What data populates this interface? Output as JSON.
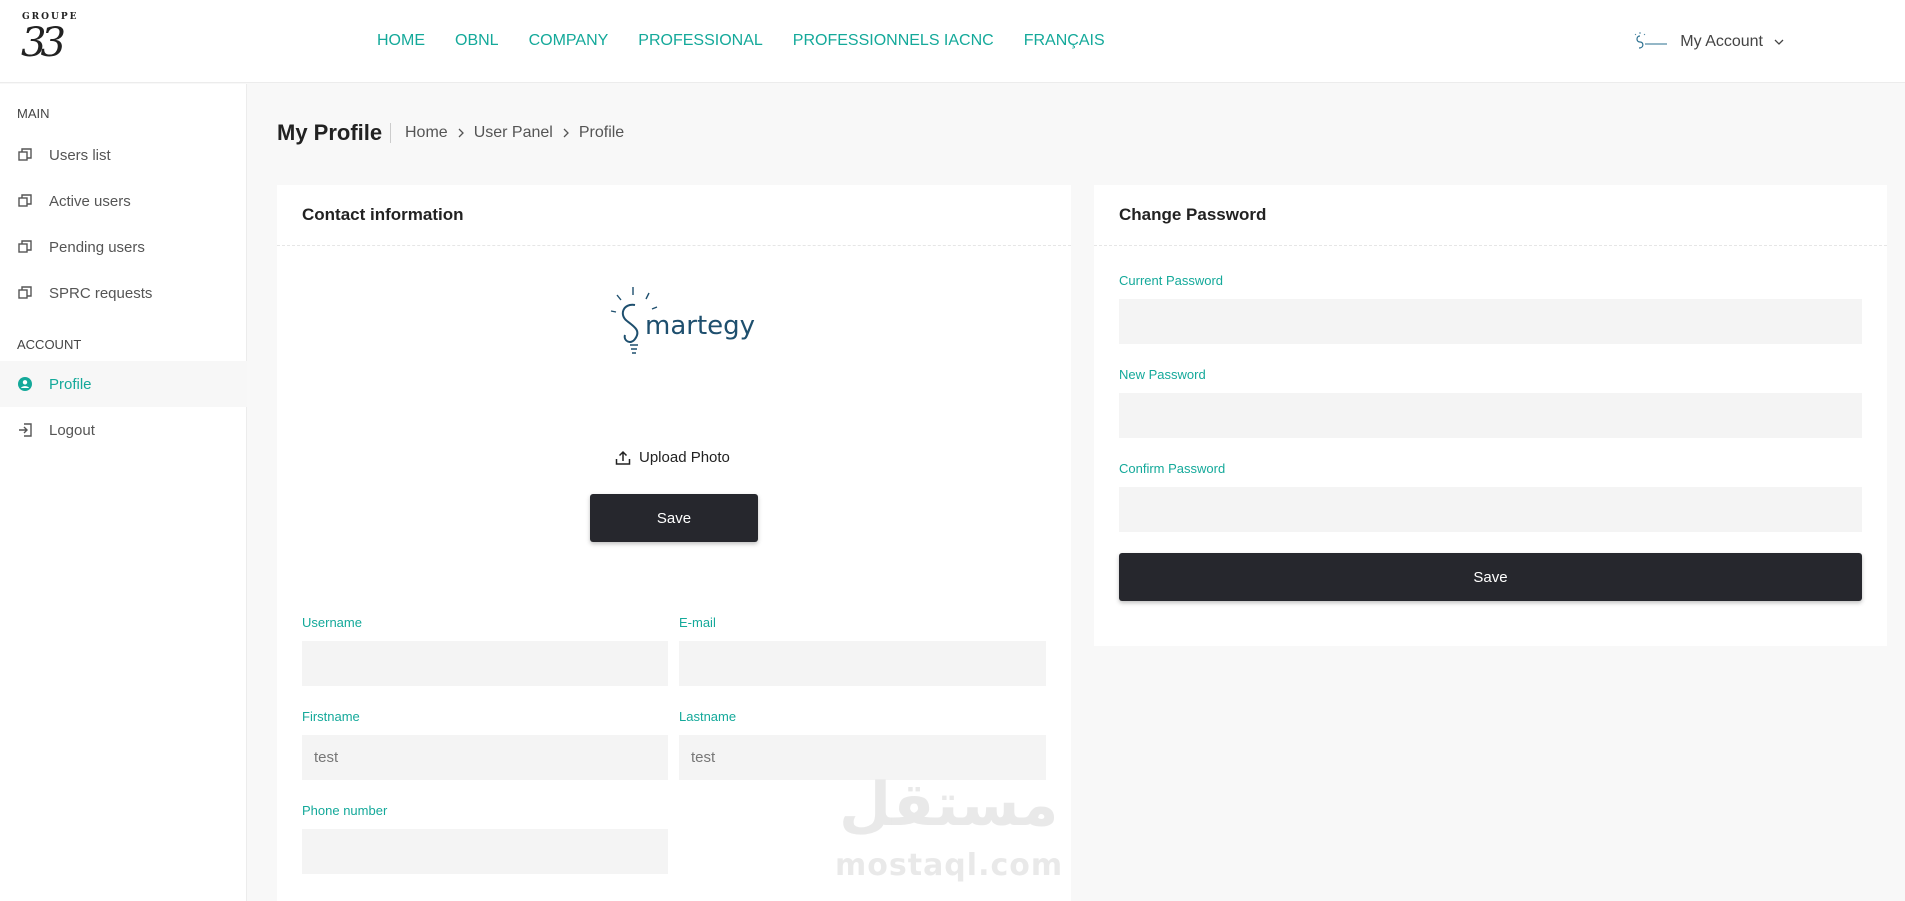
{
  "brand": {
    "word": "GROUPE",
    "number": "33"
  },
  "nav": [
    "HOME",
    "OBNL",
    "COMPANY",
    "PROFESSIONAL",
    "PROFESSIONNELS IACNC",
    "FRANÇAIS"
  ],
  "account": {
    "label": "My Account"
  },
  "sidebar": {
    "main_label": "MAIN",
    "main_items": [
      "Users list",
      "Active users",
      "Pending users",
      "SPRC requests"
    ],
    "account_label": "ACCOUNT",
    "profile": "Profile",
    "logout": "Logout"
  },
  "page": {
    "title": "My Profile",
    "breadcrumb": [
      "Home",
      "User Panel",
      "Profile"
    ]
  },
  "contact": {
    "title": "Contact information",
    "logo_text": "martegy",
    "upload_label": "Upload Photo",
    "save_label": "Save",
    "fields": {
      "username_label": "Username",
      "username_value": "",
      "email_label": "E-mail",
      "email_value": "",
      "firstname_label": "Firstname",
      "firstname_value": "test",
      "lastname_label": "Lastname",
      "lastname_value": "test",
      "phone_label": "Phone number",
      "phone_value": ""
    }
  },
  "password": {
    "title": "Change Password",
    "current_label": "Current Password",
    "new_label": "New Password",
    "confirm_label": "Confirm Password",
    "save_label": "Save"
  },
  "watermark": {
    "arabic": "مستقل",
    "latin": "mostaql.com"
  },
  "colors": {
    "accent": "#14a99a",
    "dark_button": "#26272d",
    "input_bg": "#f4f4f4"
  }
}
